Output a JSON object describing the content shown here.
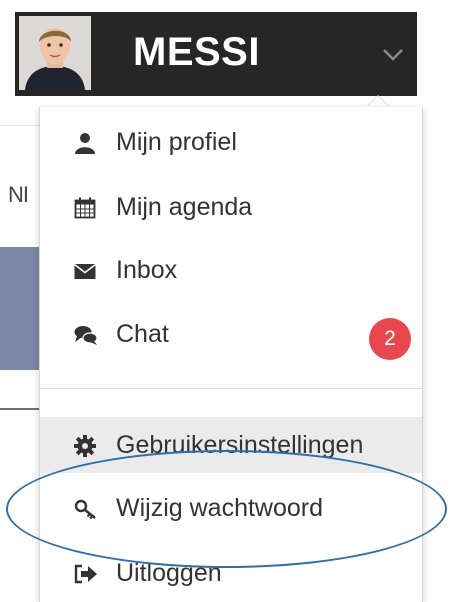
{
  "header": {
    "username": "MESSI",
    "avatar_icon": "user-avatar",
    "caret_icon": "chevron-down-icon"
  },
  "background": {
    "partial_text": "NI"
  },
  "menu": {
    "items": [
      {
        "label": "Mijn profiel",
        "icon": "user-icon"
      },
      {
        "label": "Mijn agenda",
        "icon": "calendar-icon"
      },
      {
        "label": "Inbox",
        "icon": "envelope-icon"
      },
      {
        "label": "Chat",
        "icon": "chat-icon",
        "badge": "2"
      },
      {
        "label": "Gebruikersinstellingen",
        "icon": "gear-icon"
      },
      {
        "label": "Wijzig wachtwoord",
        "icon": "key-icon"
      },
      {
        "label": "Uitloggen",
        "icon": "sign-out-icon"
      }
    ]
  },
  "colors": {
    "header_bg": "#262626",
    "badge_bg": "#e8474d",
    "highlight_bg": "#ebebeb",
    "annotation_oval": "#2f6ea8"
  }
}
